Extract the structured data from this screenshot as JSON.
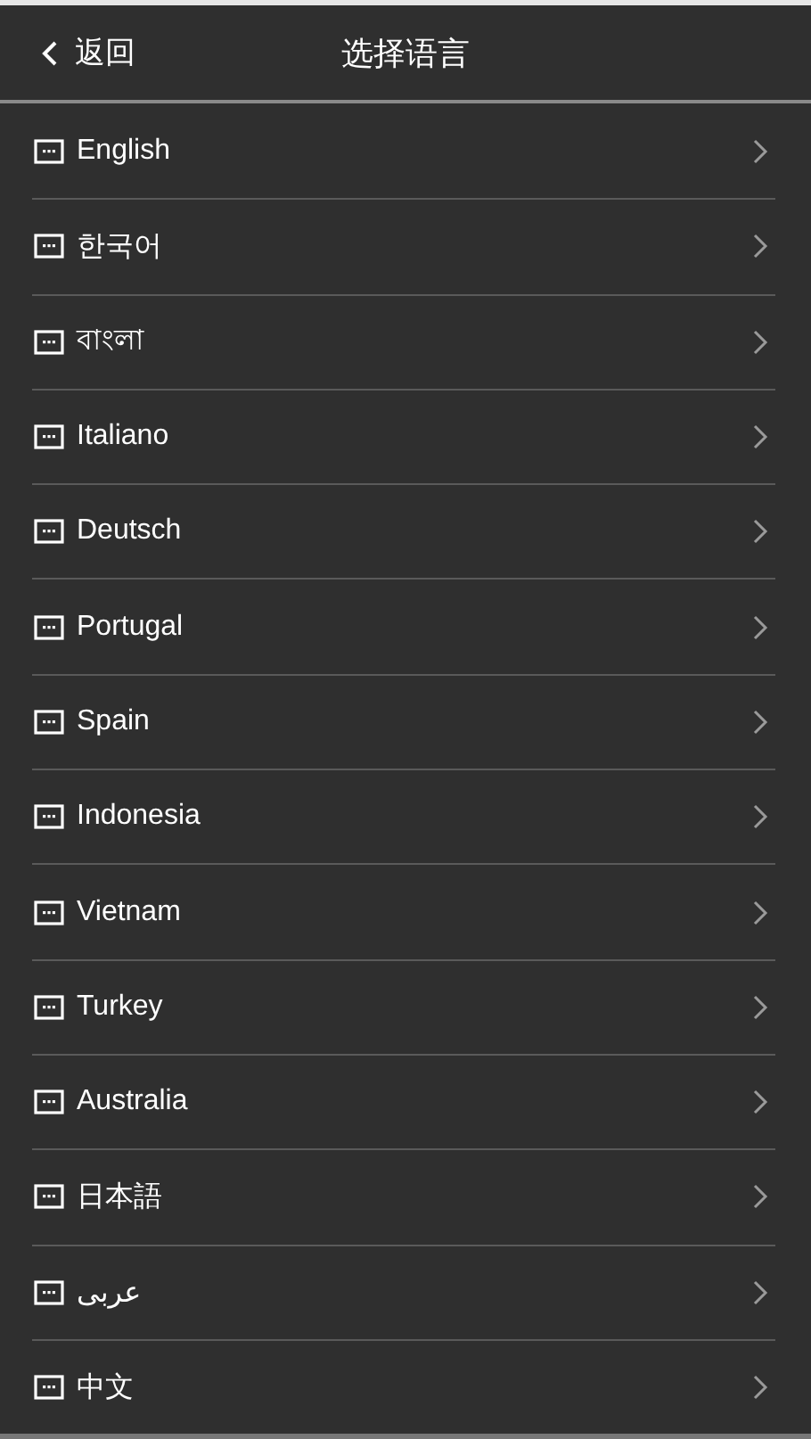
{
  "header": {
    "back_label": "返回",
    "title": "选择语言"
  },
  "languages": [
    {
      "label": "English"
    },
    {
      "label": "한국어"
    },
    {
      "label": "বাংলা"
    },
    {
      "label": "Italiano"
    },
    {
      "label": "Deutsch"
    },
    {
      "label": "Portugal"
    },
    {
      "label": "Spain"
    },
    {
      "label": "Indonesia"
    },
    {
      "label": "Vietnam"
    },
    {
      "label": "Turkey"
    },
    {
      "label": "Australia"
    },
    {
      "label": "日本語"
    },
    {
      "label": "عربى"
    },
    {
      "label": "中文"
    }
  ]
}
